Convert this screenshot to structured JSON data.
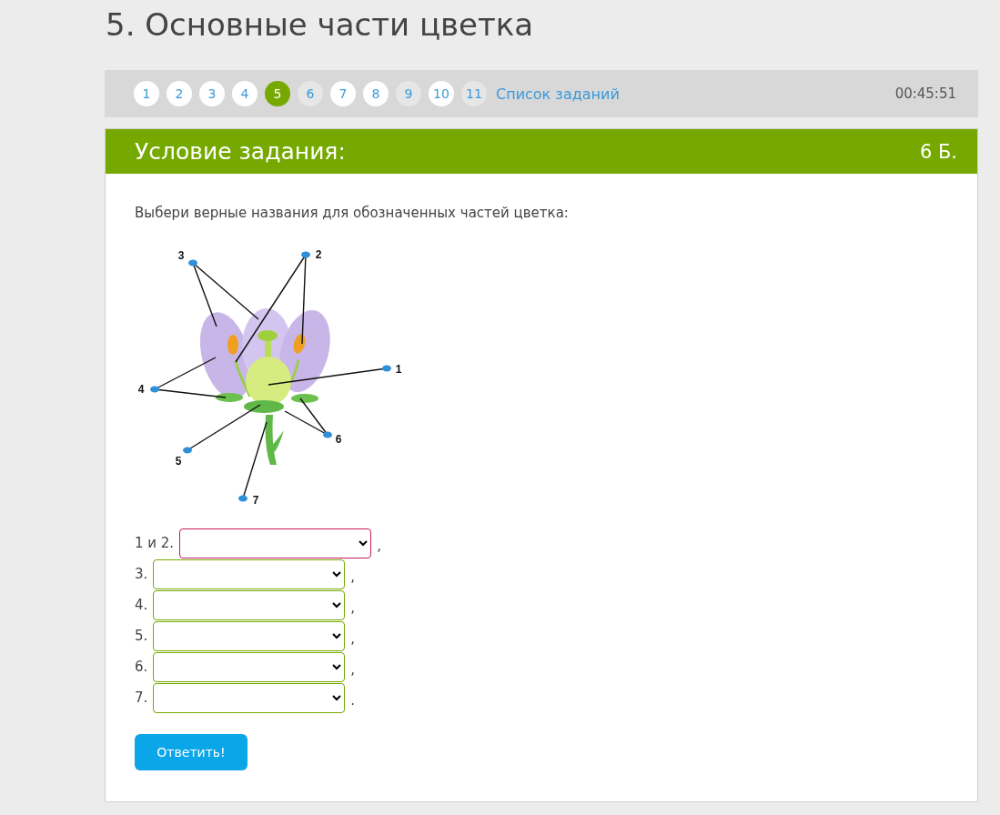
{
  "page_title": "5. Основные части цветка",
  "nav": {
    "pages": [
      {
        "label": "1",
        "selected": false,
        "answered": true
      },
      {
        "label": "2",
        "selected": false,
        "answered": true
      },
      {
        "label": "3",
        "selected": false,
        "answered": true
      },
      {
        "label": "4",
        "selected": false,
        "answered": true
      },
      {
        "label": "5",
        "selected": true,
        "answered": false
      },
      {
        "label": "6",
        "selected": false,
        "answered": false
      },
      {
        "label": "7",
        "selected": false,
        "answered": true
      },
      {
        "label": "8",
        "selected": false,
        "answered": true
      },
      {
        "label": "9",
        "selected": false,
        "answered": false
      },
      {
        "label": "10",
        "selected": false,
        "answered": true
      },
      {
        "label": "11",
        "selected": false,
        "answered": false
      }
    ],
    "task_list_link": "Список заданий",
    "timer": "00:45:51"
  },
  "task": {
    "header": "Условие задания:",
    "points": "6 Б.",
    "instruction": "Выбери верные названия для обозначенных частей цветка:",
    "diagram_labels": [
      "1",
      "2",
      "3",
      "4",
      "5",
      "6",
      "7"
    ],
    "answers": [
      {
        "label": "1 и 2.",
        "focused": true,
        "suffix": ","
      },
      {
        "label": "3.",
        "focused": false,
        "suffix": ","
      },
      {
        "label": "4.",
        "focused": false,
        "suffix": ","
      },
      {
        "label": "5.",
        "focused": false,
        "suffix": ","
      },
      {
        "label": "6.",
        "focused": false,
        "suffix": ","
      },
      {
        "label": "7.",
        "focused": false,
        "suffix": "."
      }
    ],
    "submit": "Ответить!"
  }
}
